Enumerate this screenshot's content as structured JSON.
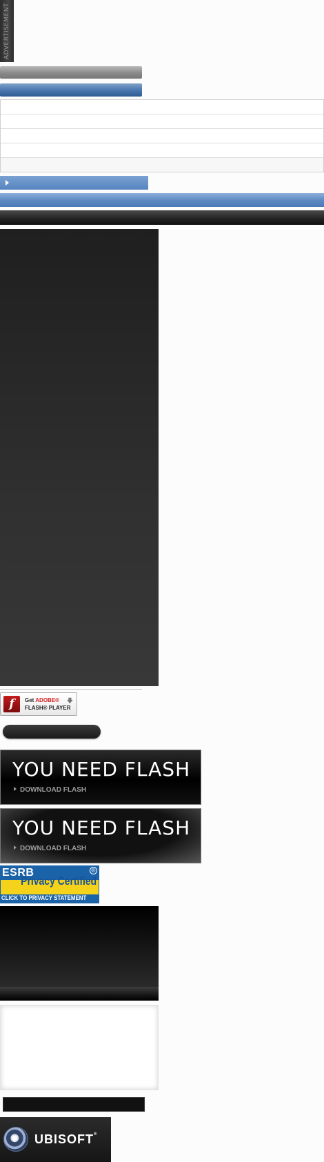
{
  "advertisement": {
    "label": "ADVERTISEMENT"
  },
  "flash_badge": {
    "line1_prefix": "Get",
    "line1_brand": "ADOBE",
    "line1_mark": "®",
    "line2": "FLASH® PLAYER",
    "icon": "flash-icon",
    "download_icon": "download-arrow-icon"
  },
  "flash_prompts": [
    {
      "title": "YOU NEED FLASH",
      "link_label": "DOWNLOAD FLASH"
    },
    {
      "title": "YOU NEED FLASH",
      "link_label": "DOWNLOAD FLASH"
    }
  ],
  "esrb": {
    "brand": "ESRB",
    "registered": "®",
    "certified": "Privacy Certified",
    "cta": "CLICK TO PRIVACY STATEMENT"
  },
  "ubisoft": {
    "wordmark": "UBISOFT",
    "mark": "®",
    "icon": "ubisoft-swirl-icon"
  },
  "colors": {
    "accent_blue": "#5684c0",
    "esrb_blue": "#1b63a8",
    "esrb_yellow": "#f5d31b",
    "flash_red": "#c31a1a"
  }
}
